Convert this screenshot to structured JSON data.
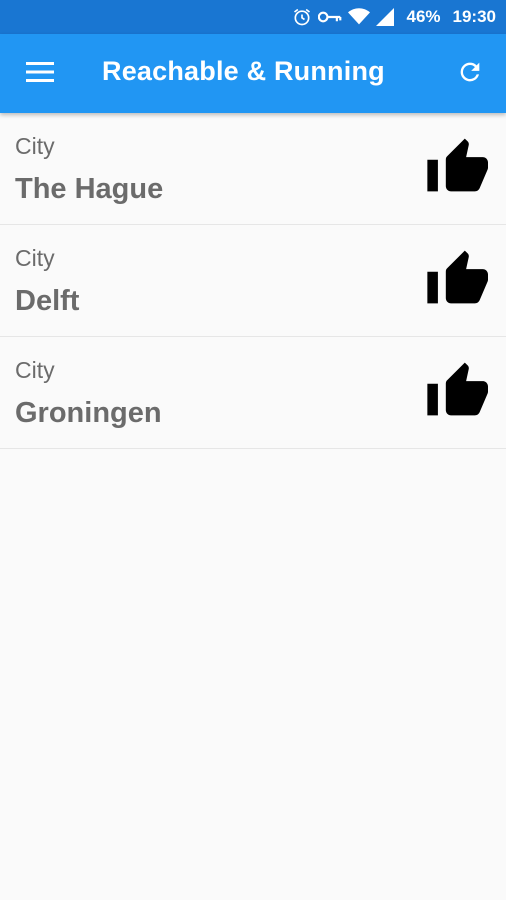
{
  "status_bar": {
    "battery": "46%",
    "time": "19:30",
    "icons": [
      "alarm-icon",
      "vpn-key-icon",
      "wifi-icon",
      "cell-signal-icon"
    ]
  },
  "app_bar": {
    "title": "Reachable & Running",
    "menu_icon": "menu-icon",
    "refresh_icon": "refresh-icon"
  },
  "list": {
    "items": [
      {
        "label": "City",
        "value": "The Hague",
        "icon": "thumbs-up-icon"
      },
      {
        "label": "City",
        "value": "Delft",
        "icon": "thumbs-up-icon"
      },
      {
        "label": "City",
        "value": "Groningen",
        "icon": "thumbs-up-icon"
      }
    ]
  },
  "colors": {
    "status_bar": "#1976d2",
    "app_bar": "#2196f3",
    "background": "#fafafa",
    "text": "#6b6b6b",
    "icon": "#000000"
  }
}
